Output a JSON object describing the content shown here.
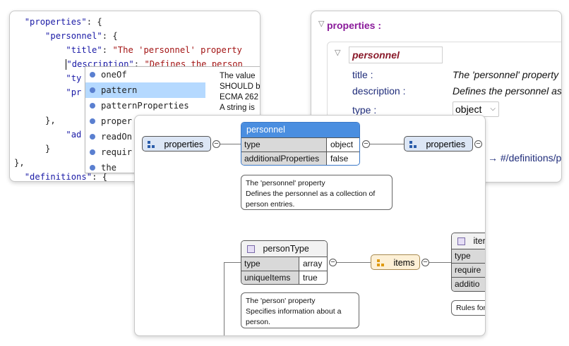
{
  "code_editor": {
    "lines": [
      {
        "indent": "  ",
        "key": "\"properties\"",
        "rest": ": {"
      },
      {
        "indent": "      ",
        "key": "\"personnel\"",
        "rest": ": {"
      },
      {
        "indent": "          ",
        "key": "\"title\"",
        "rest": ": ",
        "str": "\"The 'personnel' property"
      },
      {
        "indent": "          ",
        "key": "\"description\"",
        "rest": ": ",
        "str": "\"Defines the person"
      },
      {
        "indent": "          ",
        "key": "\"ty",
        "rest": ""
      },
      {
        "indent": "          ",
        "key": "\"pr",
        "rest": ""
      },
      {
        "indent": "",
        "key": "",
        "rest": ""
      },
      {
        "indent": "      ",
        "key": "",
        "rest": "},"
      },
      {
        "indent": "          ",
        "key": "\"ad",
        "rest": ""
      },
      {
        "indent": "      ",
        "key": "",
        "rest": "}"
      },
      {
        "indent": "",
        "key": "",
        "rest": "},"
      },
      {
        "indent": "  ",
        "key": "\"definitions\"",
        "rest": ": {"
      }
    ],
    "autocomplete": {
      "items": [
        "oneOf",
        "pattern",
        "patternProperties",
        "proper",
        "readOn",
        "requir",
        "the"
      ],
      "selected_index": 1,
      "doc_lines": [
        "The value",
        "SHOULD b",
        "ECMA 262",
        "A string is"
      ]
    }
  },
  "grid_editor": {
    "properties_label": "properties :",
    "personnel_label": "personnel",
    "rows": [
      {
        "key": "title :",
        "value": "The 'personnel' property"
      },
      {
        "key": "description :",
        "value": "Defines the personnel as"
      }
    ],
    "type_key": "type :",
    "type_value": "object",
    "ref_text": "→ #/definitions/p"
  },
  "diagram": {
    "left_properties_label": "properties",
    "right_properties_label": "properties",
    "personnel_node": {
      "title": "personnel",
      "rows": [
        {
          "key": "type",
          "value": "object"
        },
        {
          "key": "additionalProperties",
          "value": "false"
        }
      ],
      "note": [
        "The 'personnel' property",
        "Defines the personnel as a collection of",
        "person entries."
      ]
    },
    "persontype_node": {
      "title": "personType",
      "rows": [
        {
          "key": "type",
          "value": "array"
        },
        {
          "key": "uniqueItems",
          "value": "true"
        }
      ],
      "note": [
        "The 'person' property",
        "Specifies information about a",
        "person."
      ]
    },
    "items_label": "items",
    "item_node": {
      "title": "iter",
      "rows": [
        {
          "key": "type"
        },
        {
          "key": "require"
        },
        {
          "key": "additio"
        }
      ],
      "note": [
        "Rules for"
      ]
    },
    "colors": {
      "node_header": "#4a8ee0",
      "node_header_text": "#ffffff",
      "properties_bg": "#dce6f5",
      "items_bg": "#fdf0d6",
      "key_cell_bg": "#d9d9d9",
      "selection": "#b5d9ff"
    }
  }
}
